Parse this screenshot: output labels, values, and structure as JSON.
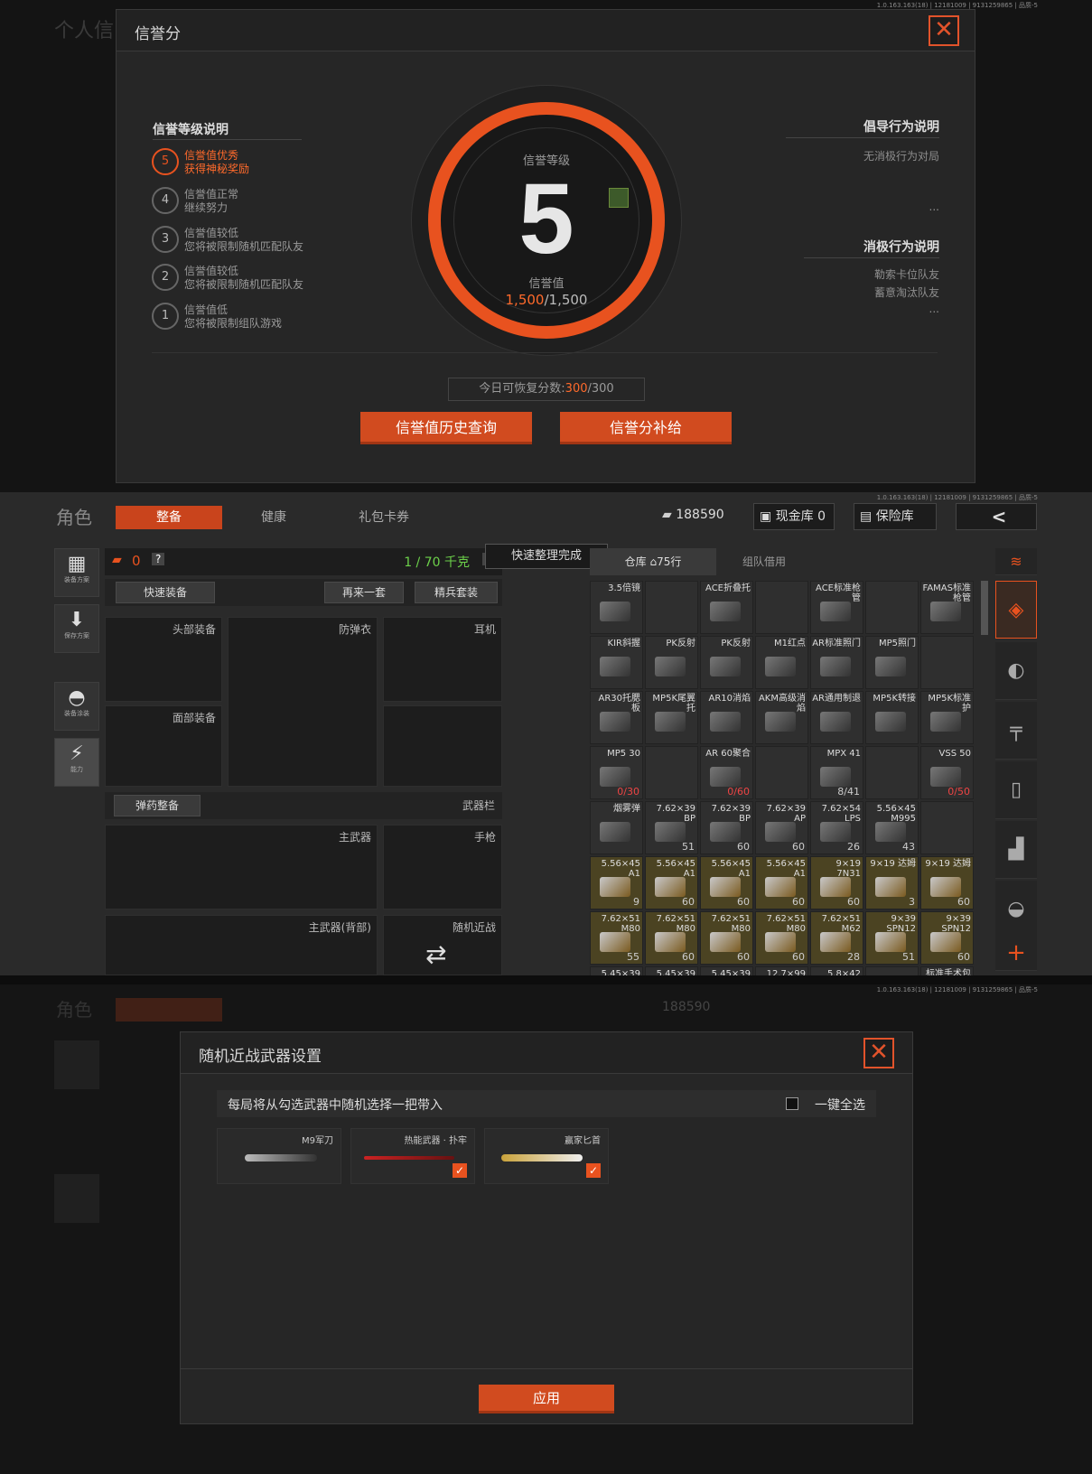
{
  "version_tag": "1.0.163.163(18) | 12181009 | 9131259865 | 品质-5",
  "p1": {
    "bg_title": "个人信",
    "title": "信誉分",
    "close": "✕",
    "level_title": "信誉等级",
    "level": "5",
    "score_label": "信誉值",
    "score_current": "1,500",
    "score_max": "/1,500",
    "left_section": "信誉等级说明",
    "levels": [
      {
        "n": "5",
        "l1": "信誉值优秀",
        "l2": "获得神秘奖励"
      },
      {
        "n": "4",
        "l1": "信誉值正常",
        "l2": "继续努力"
      },
      {
        "n": "3",
        "l1": "信誉值较低",
        "l2": "您将被限制随机匹配队友"
      },
      {
        "n": "2",
        "l1": "信誉值较低",
        "l2": "您将被限制随机匹配队友"
      },
      {
        "n": "1",
        "l1": "信誉值低",
        "l2": "您将被限制组队游戏"
      }
    ],
    "right1_title": "倡导行为说明",
    "right1_items": [
      "无消极行为对局",
      "..."
    ],
    "right2_title": "消极行为说明",
    "right2_items": [
      "勒索卡位队友",
      "蓄意淘汰队友",
      "..."
    ],
    "recover_label": "今日可恢复分数:",
    "recover_current": "300",
    "recover_max": "/300",
    "btn_history": "信誉值历史查询",
    "btn_supply": "信誉分补给"
  },
  "p2": {
    "page_title": "角色",
    "tabs": [
      "整备",
      "健康",
      "礼包卡券"
    ],
    "money": "188590",
    "cash_vault": "现金库 0",
    "safe": "保险库",
    "back": "<",
    "left_nav": [
      "装备方案",
      "保存方案",
      "装备涂装",
      "能力"
    ],
    "left_counter": "0",
    "weight": "1 / 70 千克",
    "help": "?",
    "quick_equip": "快速装备",
    "again": "再来一套",
    "elite": "精兵套装",
    "slots": {
      "head": "头部装备",
      "armor": "防弹衣",
      "ear": "耳机",
      "face": "面部装备",
      "ammo": "弹药整备",
      "weapon_bar": "武器栏",
      "main": "主武器",
      "pistol": "手枪",
      "main_back": "主武器(背部)",
      "melee": "随机近战"
    },
    "tooltip": "快速整理完成",
    "store_tab": "仓库",
    "store_rows": "75行",
    "team_tab": "组队借用",
    "grid": [
      {
        "n": "3.5倍镜",
        "q": ""
      },
      {
        "n": "",
        "q": ""
      },
      {
        "n": "ACE折叠托",
        "q": ""
      },
      {
        "n": "",
        "q": ""
      },
      {
        "n": "ACE标准枪管",
        "q": ""
      },
      {
        "n": "",
        "q": ""
      },
      {
        "n": "FAMAS标准枪管",
        "q": ""
      },
      {
        "n": "KIR斜握",
        "q": ""
      },
      {
        "n": "PK反射",
        "q": ""
      },
      {
        "n": "PK反射",
        "q": ""
      },
      {
        "n": "M1红点",
        "q": ""
      },
      {
        "n": "AR标准照门",
        "q": ""
      },
      {
        "n": "MP5照门",
        "q": ""
      },
      {
        "n": "",
        "q": ""
      },
      {
        "n": "AR30托腮板",
        "q": ""
      },
      {
        "n": "MP5K尾翼托",
        "q": ""
      },
      {
        "n": "AR10消焰",
        "q": ""
      },
      {
        "n": "AKM高级消焰",
        "q": ""
      },
      {
        "n": "AR通用制退",
        "q": ""
      },
      {
        "n": "MP5K转接",
        "q": ""
      },
      {
        "n": "MP5K标准护",
        "q": ""
      },
      {
        "n": "MP5 30",
        "q": "0/30"
      },
      {
        "n": "",
        "q": ""
      },
      {
        "n": "AR 60聚合",
        "q": "0/60"
      },
      {
        "n": "",
        "q": ""
      },
      {
        "n": "MPX 41",
        "q": "8/41"
      },
      {
        "n": "",
        "q": ""
      },
      {
        "n": "VSS 50",
        "q": "0/50"
      },
      {
        "n": "烟雾弹",
        "q": ""
      },
      {
        "n": "7.62×39 BP",
        "q": "51"
      },
      {
        "n": "7.62×39 BP",
        "q": "60"
      },
      {
        "n": "7.62×39 AP",
        "q": "60"
      },
      {
        "n": "7.62×54 LPS",
        "q": "26"
      },
      {
        "n": "5.56×45 M995",
        "q": "43"
      },
      {
        "n": "",
        "q": ""
      },
      {
        "n": "5.56×45 A1",
        "q": "9"
      },
      {
        "n": "5.56×45 A1",
        "q": "60"
      },
      {
        "n": "5.56×45 A1",
        "q": "60"
      },
      {
        "n": "5.56×45 A1",
        "q": "60"
      },
      {
        "n": "9×19 7N31",
        "q": "60"
      },
      {
        "n": "9×19 达姆",
        "q": "3"
      },
      {
        "n": "9×19 达姆",
        "q": "60"
      },
      {
        "n": "7.62×51 M80",
        "q": "55"
      },
      {
        "n": "7.62×51 M80",
        "q": "60"
      },
      {
        "n": "7.62×51 M80",
        "q": "60"
      },
      {
        "n": "7.62×51 M80",
        "q": "60"
      },
      {
        "n": "7.62×51 M62",
        "q": "28"
      },
      {
        "n": "9×39 SPN12",
        "q": "51"
      },
      {
        "n": "9×39 SPN12",
        "q": "60"
      },
      {
        "n": "5.45×39",
        "q": ""
      },
      {
        "n": "5.45×39",
        "q": ""
      },
      {
        "n": "5.45×39",
        "q": ""
      },
      {
        "n": "12.7×99",
        "q": ""
      },
      {
        "n": "5.8×42",
        "q": ""
      },
      {
        "n": "",
        "q": ""
      },
      {
        "n": "标准手术包",
        "q": ""
      }
    ]
  },
  "p3": {
    "title": "随机近战武器设置",
    "close": "✕",
    "desc": "每局将从勾选武器中随机选择一把带入",
    "select_all": "一键全选",
    "weapons": [
      {
        "n": "M9军刀",
        "checked": false
      },
      {
        "n": "热能武器 · 扑牢",
        "checked": true
      },
      {
        "n": "赢家匕首",
        "checked": true
      }
    ],
    "apply": "应用"
  }
}
